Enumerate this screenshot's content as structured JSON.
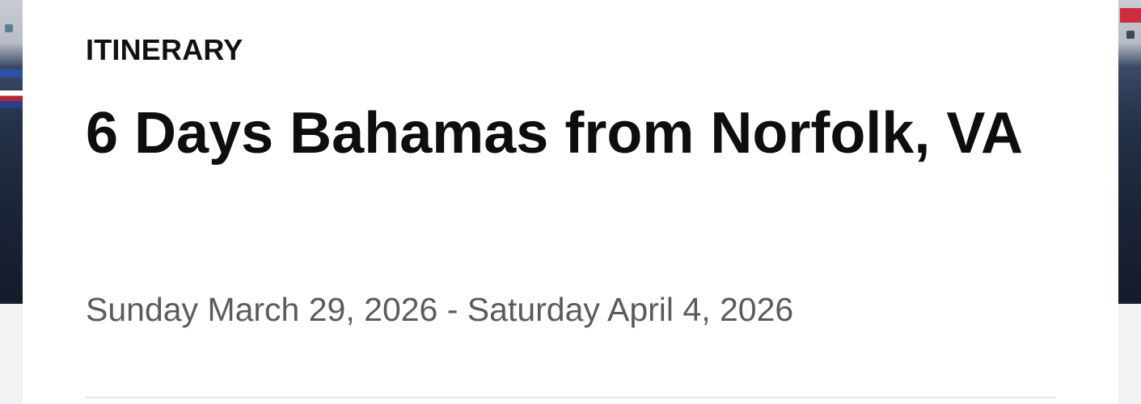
{
  "itinerary": {
    "eyebrow": "ITINERARY",
    "title": "6 Days Bahamas from Norfolk, VA",
    "dates": "Sunday March 29, 2026 - Saturday April 4, 2026"
  },
  "colors": {
    "background": "#f2f2f4",
    "card": "#ffffff",
    "title_text": "#0e0e0e",
    "date_text": "#5b5b5f",
    "divider": "#e2e2e6"
  }
}
